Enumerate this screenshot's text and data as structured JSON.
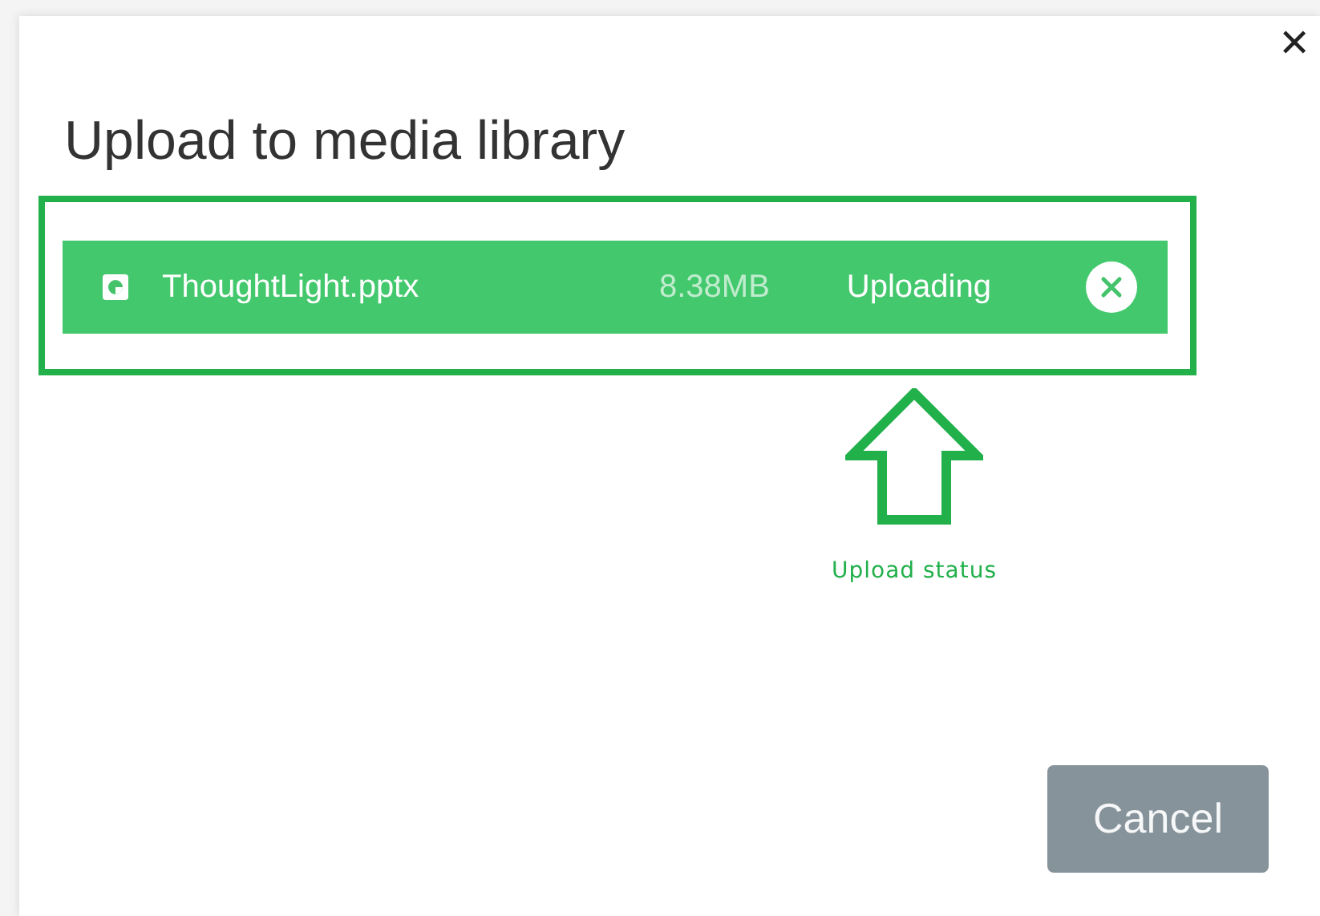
{
  "dialog": {
    "title": "Upload to media library",
    "close_label": "✕"
  },
  "files": [
    {
      "name": "ThoughtLight.pptx",
      "size": "8.38MB",
      "status": "Uploading"
    }
  ],
  "annotation": {
    "label": "Upload status"
  },
  "buttons": [
    {
      "label": "Cancel"
    }
  ]
}
